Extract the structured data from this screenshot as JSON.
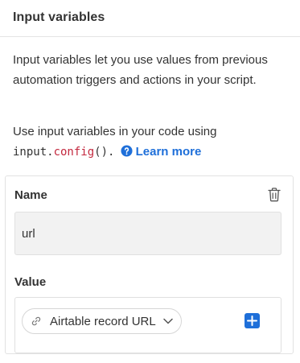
{
  "header": {
    "title": "Input variables"
  },
  "description": "Input variables let you use values from previous automation triggers and actions in your script.",
  "usage": {
    "prefix": "Use input variables in your code using",
    "code_object": "input.",
    "code_method": "config",
    "code_suffix": "().",
    "learn_more_label": "Learn more",
    "help_icon": "question-circle-icon"
  },
  "variable": {
    "name_label": "Name",
    "name_value": "url",
    "delete_icon": "trash-icon",
    "value_label": "Value",
    "value_token": {
      "label": "Airtable record URL",
      "icon": "link-icon",
      "dropdown_icon": "chevron-down-icon"
    },
    "add_icon": "plus-icon"
  },
  "colors": {
    "accent": "#1e6fd9",
    "code_keyword": "#c3283e",
    "text": "#333333",
    "input_bg": "#f2f2f2",
    "border": "#e0e0e0"
  }
}
